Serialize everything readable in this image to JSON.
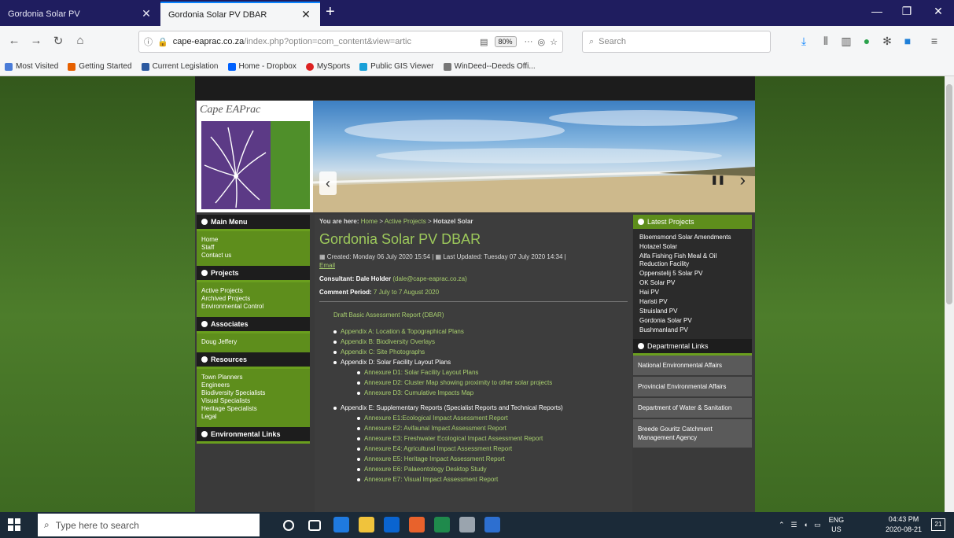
{
  "browser": {
    "tabs": [
      {
        "label": "Gordonia Solar PV",
        "active": false
      },
      {
        "label": "Gordonia Solar PV DBAR",
        "active": true
      }
    ],
    "url_main": "cape-eaprac.co.za",
    "url_rest": "/index.php?option=com_content&view=artic",
    "zoom": "80%",
    "search_placeholder": "Search",
    "bookmarks": [
      {
        "label": "Most Visited",
        "color": "#4a7cd8"
      },
      {
        "label": "Getting Started",
        "color": "#e66000"
      },
      {
        "label": "Current Legislation",
        "color": "#2c5aa0"
      },
      {
        "label": "Home - Dropbox",
        "color": "#0061fe"
      },
      {
        "label": "MySports",
        "color": "#d22"
      },
      {
        "label": "Public GIS Viewer",
        "color": "#19a0d8"
      },
      {
        "label": "WinDeed--Deeds Offi...",
        "color": "#777"
      }
    ]
  },
  "site": {
    "logo_text": "Cape EAPrac",
    "breadcrumb": {
      "prefix": "You are here:",
      "home": "Home",
      "sep": ">",
      "active": "Active Projects",
      "current": "Hotazel Solar"
    },
    "title": "Gordonia Solar PV DBAR",
    "meta_created": "Created: Monday 06 July 2020 15:54 |",
    "meta_updated": "Last Updated: Tuesday 07 July 2020 14:34 |",
    "meta_email": "Email",
    "consultant_label": "Consultant: Dale Holder",
    "consultant_email": "(dale@cape-eaprac.co.za)",
    "comment_label": "Comment Period:",
    "comment_value": "7 July to 7 August 2020",
    "documents": {
      "main": "Draft Basic Assessment Report (DBAR)",
      "appendices": [
        {
          "label": "Appendix A: Location & Topographical Plans",
          "link": true
        },
        {
          "label": "Appendix B: Biodiversity Overlays",
          "link": true
        },
        {
          "label": "Appendix C: Site Photographs",
          "link": true
        },
        {
          "label": "Appendix D: Solar Facility Layout Plans",
          "link": false,
          "annexures": [
            "Annexure D1: Solar Facility Layout Plans",
            "Annexure D2: Cluster Map showing proximity to other solar projects",
            "Annexure D3: Cumulative Impacts Map"
          ]
        },
        {
          "label": "Appendix E: Supplementary Reports (Specialist Reports and Technical Reports)",
          "link": false,
          "annexures": [
            "Annexure E1:Ecological Impact Assessment Report",
            "Annexure E2: Avifaunal Impact Assessment Report",
            "Annexure E3: Freshwater Ecological Impact Assessment Report",
            "Annexure E4: Agricultural Impact Assessment Report",
            "Annexure E5: Heritage Impact Assessment Report",
            "Annexure E6: Palaeontology Desktop Study",
            "Annexure E7: Visual Impact Assessment Report"
          ]
        }
      ]
    },
    "left_menu": [
      {
        "heading": "Main Menu",
        "items": [
          "Home",
          "Staff",
          "Contact us"
        ]
      },
      {
        "heading": "Projects",
        "items": [
          "Active Projects",
          "Archived Projects",
          "Environmental Control"
        ]
      },
      {
        "heading": "Associates",
        "items": [
          "Doug Jeffery"
        ]
      },
      {
        "heading": "Resources",
        "items": [
          "Town Planners",
          "Engineers",
          "Biodiversity Specialists",
          "Visual Specialists",
          "Heritage Specialists",
          "Legal"
        ]
      },
      {
        "heading": "Environmental Links",
        "items": []
      }
    ],
    "latest_projects": {
      "heading": "Latest Projects",
      "items": [
        "Bloemsmond Solar Amendments",
        "Hotazel Solar",
        "Alfa Fishing Fish Meal & Oil Reduction Facility",
        "Oppenstelij 5 Solar PV",
        "OK Solar PV",
        "Hai PV",
        "Haristi PV",
        "Struisland PV",
        "Gordonia Solar PV",
        "Bushmanland PV"
      ]
    },
    "departmental_links": {
      "heading": "Departmental Links",
      "items": [
        "National Environmental Affairs",
        "Provincial Environmental Affairs",
        "Department of Water & Sanitation",
        "Breede Gouritz Catchment Management Agency"
      ]
    }
  },
  "taskbar": {
    "search_placeholder": "Type here to search",
    "language": "ENG",
    "region": "US",
    "time": "04:43 PM",
    "date": "2020-08-21",
    "notifications": "21"
  }
}
